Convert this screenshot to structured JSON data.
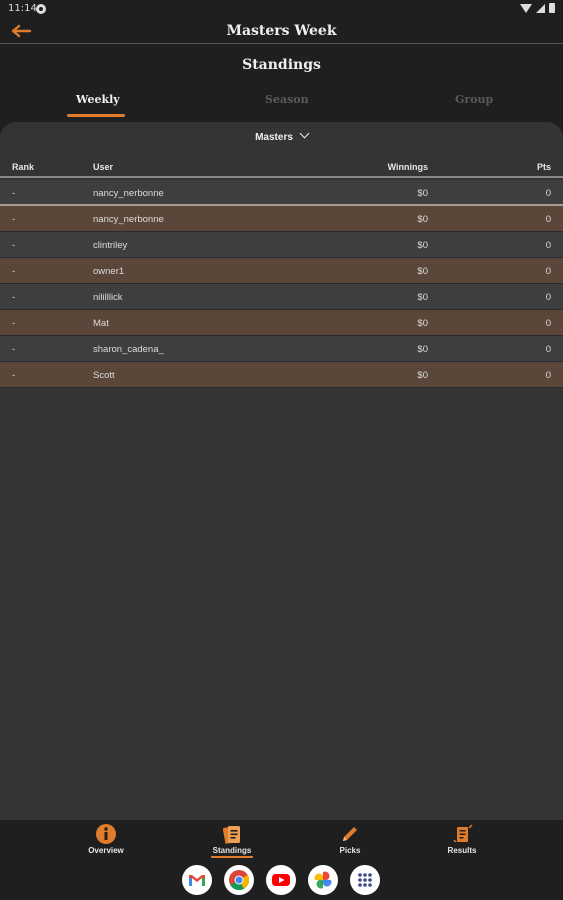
{
  "status_bar": {
    "time": "11:14"
  },
  "app_bar": {
    "title": "Masters Week"
  },
  "page": {
    "title": "Standings"
  },
  "tabs": [
    {
      "label": "Weekly",
      "active": true
    },
    {
      "label": "Season",
      "active": false
    },
    {
      "label": "Group",
      "active": false
    }
  ],
  "event_select": {
    "value": "Masters"
  },
  "table": {
    "headers": {
      "rank": "Rank",
      "user": "User",
      "winnings": "Winnings",
      "pts": "Pts"
    },
    "rows": [
      {
        "rank": "-",
        "user": "nancy_nerbonne",
        "winnings": "$0",
        "pts": "0"
      },
      {
        "rank": "-",
        "user": "nancy_nerbonne",
        "winnings": "$0",
        "pts": "0"
      },
      {
        "rank": "-",
        "user": "clintriley",
        "winnings": "$0",
        "pts": "0"
      },
      {
        "rank": "-",
        "user": "owner1",
        "winnings": "$0",
        "pts": "0"
      },
      {
        "rank": "-",
        "user": "nililllick",
        "winnings": "$0",
        "pts": "0"
      },
      {
        "rank": "-",
        "user": "Mat",
        "winnings": "$0",
        "pts": "0"
      },
      {
        "rank": "-",
        "user": "sharon_cadena_",
        "winnings": "$0",
        "pts": "0"
      },
      {
        "rank": "-",
        "user": "Scott",
        "winnings": "$0",
        "pts": "0"
      }
    ]
  },
  "bottom_nav": [
    {
      "label": "Overview",
      "icon": "info-icon"
    },
    {
      "label": "Standings",
      "icon": "standings-icon",
      "active": true
    },
    {
      "label": "Picks",
      "icon": "pencil-icon"
    },
    {
      "label": "Results",
      "icon": "results-icon"
    }
  ],
  "dock": [
    "gmail-icon",
    "chrome-icon",
    "youtube-icon",
    "photos-icon",
    "app-drawer-icon"
  ],
  "colors": {
    "accent": "#e07c2b",
    "row_alt": "#5a4739",
    "row": "#3d3e40",
    "background": "#1f1f1f",
    "card": "#333436"
  }
}
